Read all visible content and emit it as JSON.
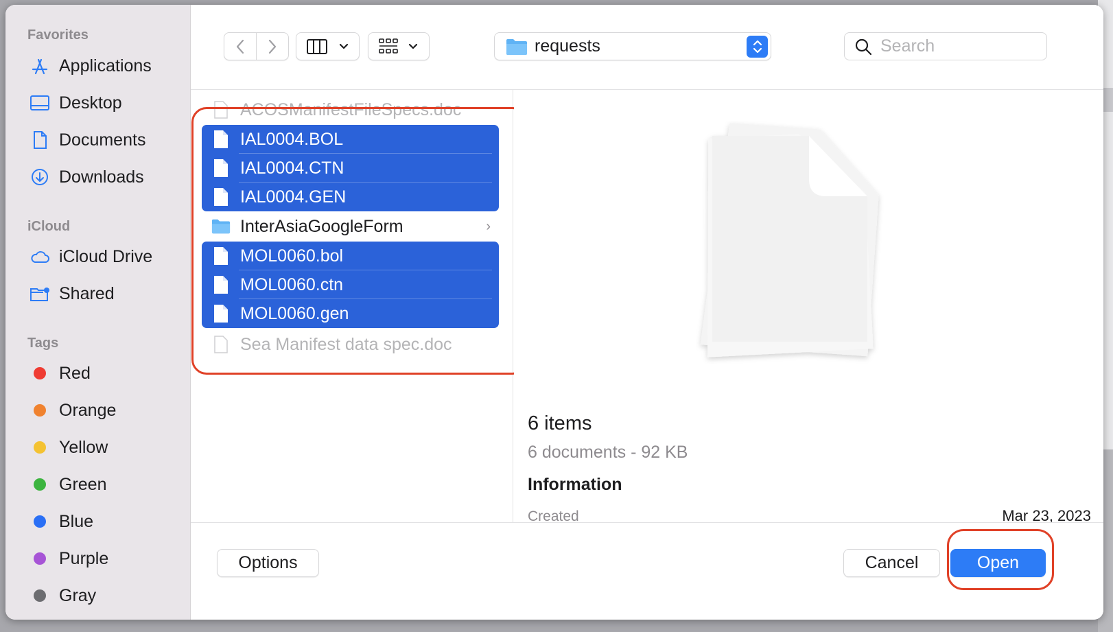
{
  "sidebar": {
    "favorites_header": "Favorites",
    "favorites": [
      {
        "label": "Applications",
        "icon": "applications-icon"
      },
      {
        "label": "Desktop",
        "icon": "desktop-icon"
      },
      {
        "label": "Documents",
        "icon": "documents-icon"
      },
      {
        "label": "Downloads",
        "icon": "downloads-icon"
      }
    ],
    "icloud_header": "iCloud",
    "icloud": [
      {
        "label": "iCloud Drive",
        "icon": "cloud-icon"
      },
      {
        "label": "Shared",
        "icon": "shared-folder-icon"
      }
    ],
    "tags_header": "Tags",
    "tags": [
      {
        "label": "Red",
        "color": "#ef3b32"
      },
      {
        "label": "Orange",
        "color": "#f0822f"
      },
      {
        "label": "Yellow",
        "color": "#f4c232"
      },
      {
        "label": "Green",
        "color": "#3cb43f"
      },
      {
        "label": "Blue",
        "color": "#2a6ff5"
      },
      {
        "label": "Purple",
        "color": "#a754d6"
      },
      {
        "label": "Gray",
        "color": "#6c6c70"
      }
    ]
  },
  "toolbar": {
    "path": "requests",
    "search_placeholder": "Search"
  },
  "files": [
    {
      "name": "ACOSManifestFileSpecs.doc",
      "selected": false,
      "dimmed": true
    },
    {
      "name": "IAL0004.BOL",
      "selected": true
    },
    {
      "name": "IAL0004.CTN",
      "selected": true
    },
    {
      "name": "IAL0004.GEN",
      "selected": true
    },
    {
      "name": "InterAsiaGoogleForm",
      "selected": false,
      "folder": true
    },
    {
      "name": "MOL0060.bol",
      "selected": true
    },
    {
      "name": "MOL0060.ctn",
      "selected": true
    },
    {
      "name": "MOL0060.gen",
      "selected": true
    },
    {
      "name": "Sea Manifest data spec.doc",
      "selected": false,
      "dimmed": true
    }
  ],
  "preview": {
    "title": "6 items",
    "subtitle": "6 documents - 92 KB",
    "info_header": "Information",
    "created_label": "Created",
    "created_value": "Mar 23, 2023"
  },
  "buttons": {
    "options": "Options",
    "cancel": "Cancel",
    "open": "Open"
  },
  "colors": {
    "accent": "#2d7cf6",
    "selection": "#2b62d9",
    "annotation": "#e04127"
  }
}
